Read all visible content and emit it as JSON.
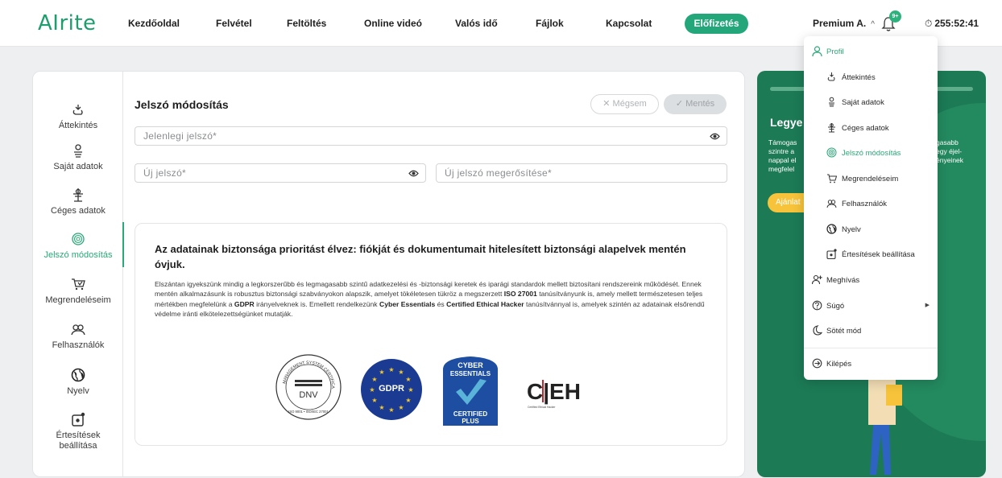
{
  "header": {
    "logo": "AIrite",
    "nav": [
      "Kezdőoldal",
      "Felvétel",
      "Feltöltés",
      "Online videó",
      "Valós idő",
      "Fájlok",
      "Kapcsolat"
    ],
    "subscribe": "Előfizetés",
    "user": "Premium A.",
    "notif_count": "9+",
    "timer": "255:52:41"
  },
  "sidebar": [
    {
      "label": "Áttekintés",
      "icon": "overview-icon"
    },
    {
      "label": "Saját adatok",
      "icon": "user-icon"
    },
    {
      "label": "Céges adatok",
      "icon": "company-icon"
    },
    {
      "label": "Jelszó módosítás",
      "icon": "fingerprint-icon",
      "active": true
    },
    {
      "label": "Megrendeléseim",
      "icon": "cart-icon"
    },
    {
      "label": "Felhasználók",
      "icon": "users-icon"
    },
    {
      "label": "Nyelv",
      "icon": "globe-icon"
    },
    {
      "label": "Értesítések beállítása",
      "icon": "notification-settings-icon"
    }
  ],
  "form": {
    "title": "Jelszó módosítás",
    "cancel": "Mégsem",
    "save": "Mentés",
    "current_placeholder": "Jelenlegi jelszó*",
    "new_placeholder": "Új jelszó*",
    "confirm_placeholder": "Új jelszó megerősítése*"
  },
  "security": {
    "heading": "Az adatainak biztonsága prioritást élvez: fiókját és dokumentumait hitelesített biztonsági alapelvek mentén óvjuk.",
    "body_1": "Elszántan igyekszünk mindig a legkorszerűbb és legmagasabb szintű adatkezelési és -biztonsági keretek és iparági standardok mellett biztosítani rendszereink működését. Ennek mentén alkalmazásunk is robusztus biztonsági szabványokon alapszik, amelyet tökéletesen tükröz a megszerzett ",
    "iso": "ISO 27001",
    "body_2": " tanúsítványunk is, amely mellett természetesen teljes mértékben megfelelünk a ",
    "gdpr": "GDPR",
    "body_3": " irányelveknek is. Emellett rendelkezünk ",
    "cyber": "Cyber Essentials",
    "body_4": " és ",
    "ceh": "Certified Ethical Hacker",
    "body_5": " tanúsítvánnyal is, amelyek szintén az adatainak elsőrendű védelme iránti elkötelezettségünket mutatják.",
    "badges": {
      "dnv_text": "DNV",
      "dnv_ring": "MANAGEMENT SYSTEM CERTIFICATION",
      "dnv_sub": "ISO 9001 • ISO/IEC 27001",
      "gdpr_text": "GDPR",
      "cyber_top": "CYBER",
      "cyber_mid": "ESSENTIALS",
      "cyber_bottom": "CERTIFIED",
      "cyber_plus": "PLUS",
      "ceh_text": "C|EH",
      "ceh_sub": "Certified Ethical Hacker"
    }
  },
  "promo": {
    "title": "Legye",
    "text_left": "Támogas\nszintre a\nnappal el\nmegfelel",
    "text_right": "gasabb\negy éjel-\nényeinek",
    "button": "Ajánlat"
  },
  "dropdown": {
    "profile": "Profil",
    "items": [
      {
        "label": "Áttekintés",
        "icon": "overview-icon"
      },
      {
        "label": "Saját adatok",
        "icon": "user-icon"
      },
      {
        "label": "Céges adatok",
        "icon": "company-icon"
      },
      {
        "label": "Jelszó módosítás",
        "icon": "fingerprint-icon",
        "active": true
      },
      {
        "label": "Megrendeléseim",
        "icon": "cart-icon"
      },
      {
        "label": "Felhasználók",
        "icon": "users-icon"
      },
      {
        "label": "Nyelv",
        "icon": "globe-icon"
      },
      {
        "label": "Értesítések beállítása",
        "icon": "notification-settings-icon"
      }
    ],
    "invite": "Meghívás",
    "help": "Súgó",
    "dark_mode": "Sötét mód",
    "logout": "Kilépés"
  },
  "colors": {
    "accent": "#2aa877",
    "promo_bg": "#1c7a55",
    "promo_btn": "#f6c33a",
    "gdpr_blue": "#1b3a91"
  }
}
